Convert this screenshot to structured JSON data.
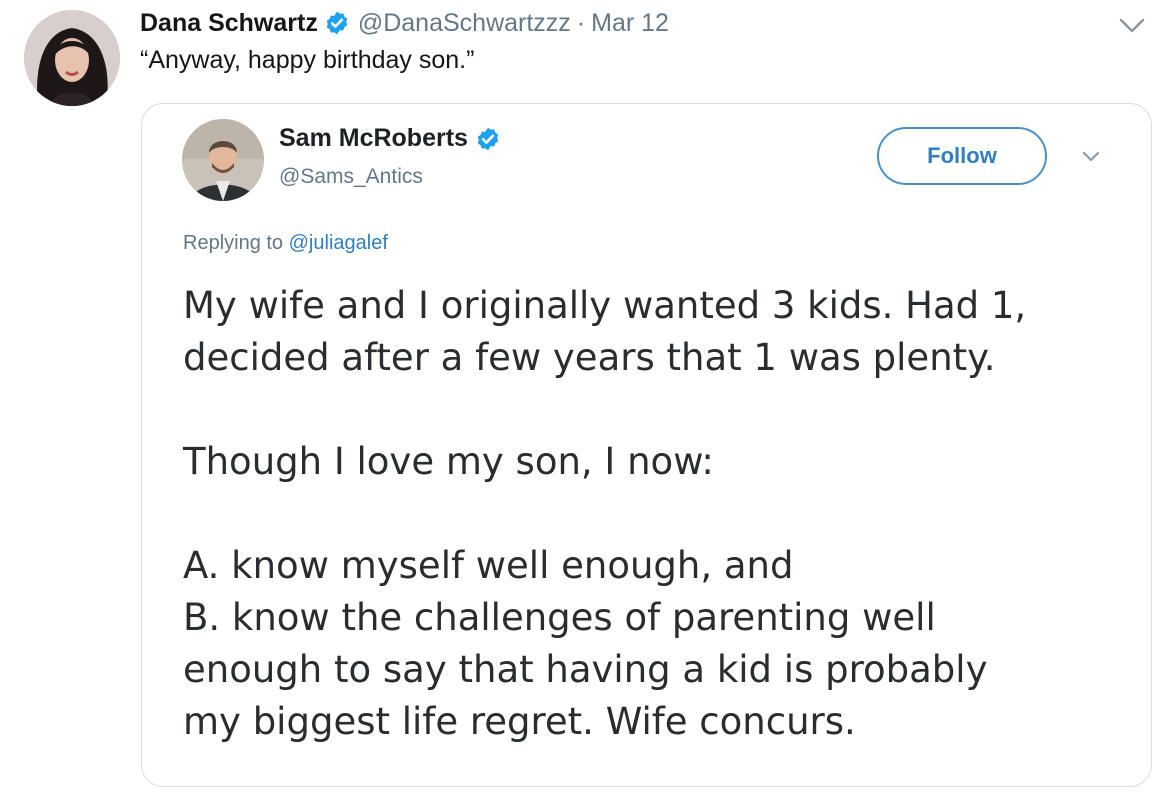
{
  "tweet": {
    "author_name": "Dana Schwartz",
    "handle": "@DanaSchwartzzz",
    "separator": "·",
    "date": "Mar 12",
    "text": "“Anyway, happy birthday son.”",
    "icons": {
      "verified": "verified-badge-icon",
      "more": "chevron-down-icon",
      "avatar": "profile-photo"
    }
  },
  "quoted_tweet": {
    "author_name": "Sam McRoberts",
    "handle": "@Sams_Antics",
    "follow_label": "Follow",
    "replying_prefix": "Replying to",
    "replying_handle": "@juliagalef",
    "body": {
      "p1_line1": "My wife and I originally wanted 3 kids. Had 1,",
      "p1_line2": "decided after a few years that 1 was plenty.",
      "p2": "Though I love my son, I now:",
      "p3_line1": "A. know myself well enough, and",
      "p3_line2": "B. know the challenges of parenting well",
      "p3_line3": "enough to say that having a kid is probably",
      "p3_line4": "my biggest life regret. Wife concurs."
    },
    "icons": {
      "verified": "verified-badge-icon",
      "more": "chevron-down-icon",
      "avatar": "profile-photo"
    }
  },
  "colors": {
    "verified_blue": "#1da1f2",
    "link_blue": "#2f7fc1",
    "secondary_text": "#657786",
    "border": "#d8dee3"
  }
}
